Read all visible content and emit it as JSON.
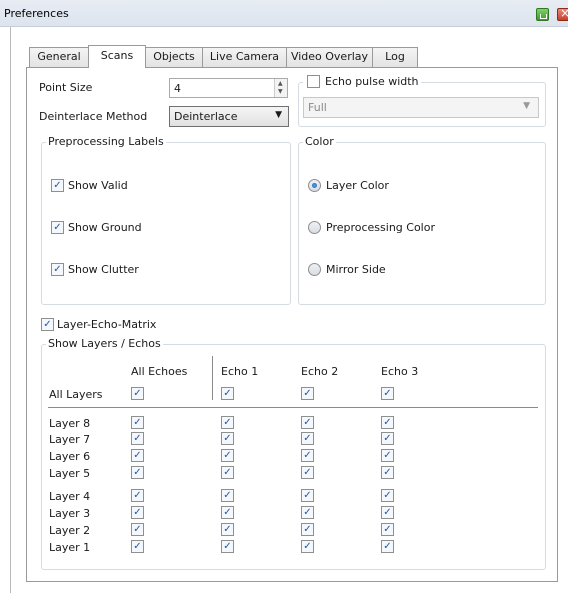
{
  "window": {
    "title": "Preferences"
  },
  "tabs": [
    {
      "label": "General",
      "active": false
    },
    {
      "label": "Scans",
      "active": true
    },
    {
      "label": "Objects",
      "active": false
    },
    {
      "label": "Live Camera",
      "active": false
    },
    {
      "label": "Video Overlay",
      "active": false
    },
    {
      "label": "Log",
      "active": false
    }
  ],
  "scans": {
    "point_size": {
      "label": "Point Size",
      "value": "4"
    },
    "deinterlace": {
      "label": "Deinterlace Method",
      "value": "Deinterlace"
    },
    "echo_pulse_width": {
      "label": "Echo pulse width",
      "checked": false,
      "value": "Full"
    },
    "preprocessing": {
      "title": "Preprocessing Labels",
      "items": [
        {
          "label": "Show Valid",
          "checked": true
        },
        {
          "label": "Show Ground",
          "checked": true
        },
        {
          "label": "Show Clutter",
          "checked": true
        }
      ]
    },
    "color": {
      "title": "Color",
      "options": [
        {
          "label": "Layer Color",
          "selected": true
        },
        {
          "label": "Preprocessing Color",
          "selected": false
        },
        {
          "label": "Mirror Side",
          "selected": false
        }
      ]
    },
    "layer_echo_matrix": {
      "label": "Layer-Echo-Matrix",
      "checked": true
    },
    "show_layers": {
      "title": "Show Layers / Echos",
      "columns": [
        "All Echoes",
        "Echo 1",
        "Echo 2",
        "Echo 3"
      ],
      "all_layers_label": "All Layers",
      "rows": [
        "Layer 8",
        "Layer 7",
        "Layer 6",
        "Layer 5",
        "Layer 4",
        "Layer 3",
        "Layer 2",
        "Layer 1"
      ]
    }
  },
  "icons": {
    "minimize": "green-window-icon",
    "close": "close-icon"
  }
}
